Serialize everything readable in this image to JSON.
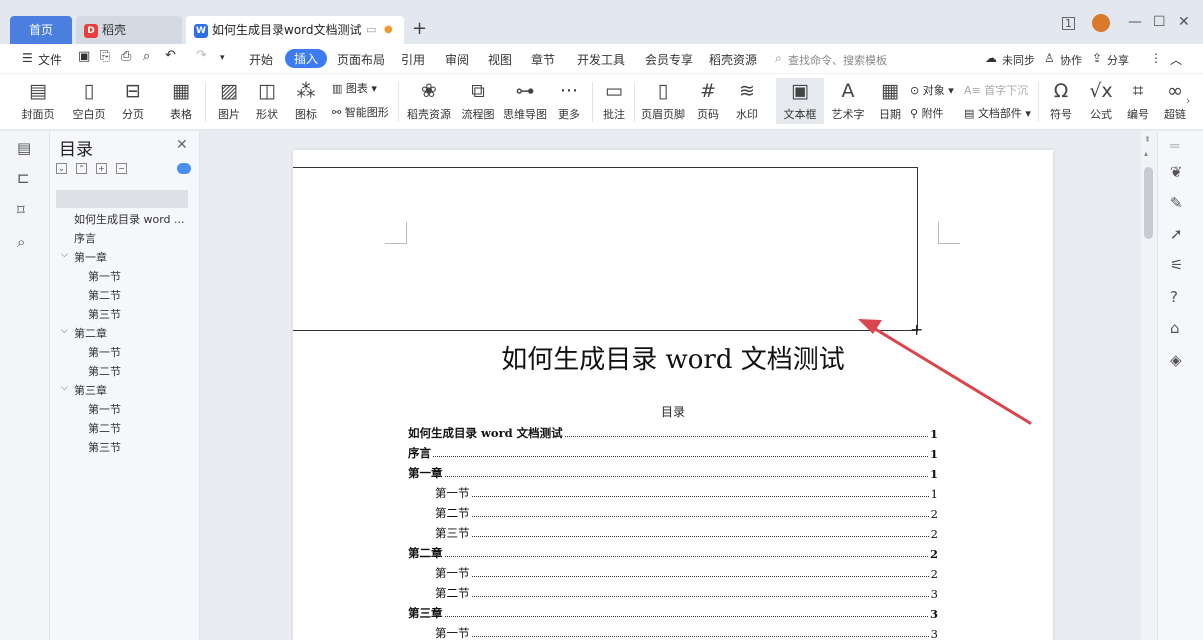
{
  "tabs": {
    "home": "首页",
    "docer": "稻壳",
    "doc": "如何生成目录word文档测试",
    "docer_logo": "D",
    "doc_logo": "W"
  },
  "menubar": {
    "file": "文件",
    "items": [
      "开始",
      "插入",
      "页面布局",
      "引用",
      "审阅",
      "视图",
      "章节",
      "开发工具",
      "会员专享",
      "稻壳资源"
    ],
    "search_placeholder": "查找命令、搜索模板",
    "sync": "未同步",
    "collab": "协作",
    "share": "分享"
  },
  "ribbon": {
    "cover": "封面页",
    "blank": "空白页",
    "pagebreak": "分页",
    "table": "表格",
    "picture": "图片",
    "shape": "形状",
    "icon": "图标",
    "chart": "图表",
    "smartart": "智能图形",
    "docer_res": "稻壳资源",
    "flowchart": "流程图",
    "mindmap": "思维导图",
    "more": "更多",
    "comment": "批注",
    "header_footer": "页眉页脚",
    "page_num": "页码",
    "watermark": "水印",
    "textbox": "文本框",
    "wordart": "艺术字",
    "date": "日期",
    "object": "对象",
    "attachment": "附件",
    "drop_cap": "首字下沉",
    "doc_parts": "文档部件",
    "symbol": "符号",
    "formula": "公式",
    "numbering": "编号",
    "super": "超链"
  },
  "toc_panel": {
    "title": "目录",
    "items": [
      {
        "text": "如何生成目录 word ...",
        "level": 0
      },
      {
        "text": "序言",
        "level": 0
      },
      {
        "text": "第一章",
        "level": 1
      },
      {
        "text": "第一节",
        "level": 2
      },
      {
        "text": "第二节",
        "level": 2
      },
      {
        "text": "第三节",
        "level": 2
      },
      {
        "text": "第二章",
        "level": 1
      },
      {
        "text": "第一节",
        "level": 2
      },
      {
        "text": "第二节",
        "level": 2
      },
      {
        "text": "第三章",
        "level": 1
      },
      {
        "text": "第一节",
        "level": 2
      },
      {
        "text": "第二节",
        "level": 2
      },
      {
        "text": "第三节",
        "level": 2
      }
    ]
  },
  "document": {
    "title": "如何生成目录 word 文档测试",
    "toc_heading": "目录",
    "toc": [
      {
        "text": "如何生成目录 word 文档测试",
        "page": "1",
        "bold": true,
        "indent": false
      },
      {
        "text": "序言",
        "page": "1",
        "bold": true,
        "indent": false
      },
      {
        "text": "第一章",
        "page": "1",
        "bold": true,
        "indent": false
      },
      {
        "text": "第一节",
        "page": "1",
        "bold": false,
        "indent": true
      },
      {
        "text": "第二节",
        "page": "2",
        "bold": false,
        "indent": true
      },
      {
        "text": "第三节",
        "page": "2",
        "bold": false,
        "indent": true
      },
      {
        "text": "第二章",
        "page": "2",
        "bold": true,
        "indent": false
      },
      {
        "text": "第一节",
        "page": "2",
        "bold": false,
        "indent": true
      },
      {
        "text": "第二节",
        "page": "3",
        "bold": false,
        "indent": true
      },
      {
        "text": "第三章",
        "page": "3",
        "bold": true,
        "indent": false
      },
      {
        "text": "第一节",
        "page": "3",
        "bold": false,
        "indent": true
      }
    ]
  },
  "colors": {
    "accent": "#3d7bf0",
    "arrow": "#d9464b"
  }
}
